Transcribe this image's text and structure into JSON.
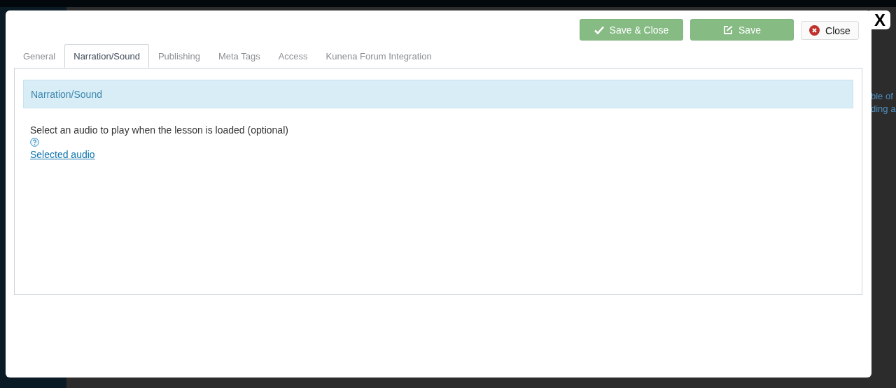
{
  "background": {
    "snippets": [
      "ble of",
      "ding a"
    ]
  },
  "modal": {
    "close_label": "X",
    "buttons": [
      {
        "kind": "save_close",
        "label": "Save & Close"
      },
      {
        "kind": "save",
        "label": "Save"
      },
      {
        "kind": "close",
        "label": "Close"
      }
    ],
    "tabs": [
      {
        "label": "General",
        "selected": false
      },
      {
        "label": "Narration/Sound",
        "selected": true
      },
      {
        "label": "Publishing",
        "selected": false
      },
      {
        "label": "Meta Tags",
        "selected": false
      },
      {
        "label": "Access",
        "selected": false
      },
      {
        "label": "Kunena Forum Integration",
        "selected": false
      }
    ],
    "panel": {
      "heading": "Narration/Sound",
      "field_label": "Select an audio to play when the lesson is loaded (optional)",
      "link": "Selected audio"
    }
  }
}
